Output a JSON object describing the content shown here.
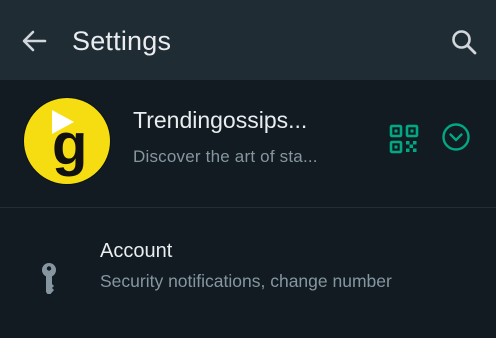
{
  "header": {
    "title": "Settings",
    "back_icon": "arrow-left-icon",
    "search_icon": "search-icon"
  },
  "profile": {
    "name": "Trendingossips...",
    "status": "Discover the art of sta...",
    "avatar_letter": "g",
    "qr_icon": "qr-code-icon",
    "expand_icon": "chevron-down-circle-icon"
  },
  "settings": {
    "account": {
      "title": "Account",
      "subtitle": "Security notifications, change number",
      "icon": "key-icon"
    }
  },
  "colors": {
    "background": "#111b21",
    "header": "#1f2c34",
    "accent": "#00a884",
    "avatar_bg": "#f5dd12",
    "primary_text": "#e9edef",
    "secondary_text": "#8696a0"
  }
}
